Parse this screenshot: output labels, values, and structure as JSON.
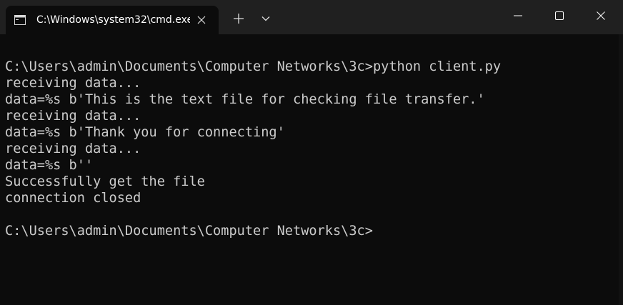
{
  "window": {
    "tab_title": "C:\\Windows\\system32\\cmd.exe",
    "tab_icon": "cmd-icon",
    "tab_close_icon": "close-icon",
    "new_tab_icon": "plus-icon",
    "dropdown_icon": "chevron-down-icon",
    "minimize_icon": "minimize-icon",
    "maximize_icon": "maximize-icon",
    "close_icon": "close-icon"
  },
  "console": {
    "lines": [
      "C:\\Users\\admin\\Documents\\Computer Networks\\3c>python client.py",
      "receiving data...",
      "data=%s b'This is the text file for checking file transfer.'",
      "receiving data...",
      "data=%s b'Thank you for connecting'",
      "receiving data...",
      "data=%s b''",
      "Successfully get the file",
      "connection closed",
      "C:\\Users\\admin\\Documents\\Computer Networks\\3c>"
    ]
  },
  "colors": {
    "titlebar": "#202020",
    "background": "#0c0c0c",
    "text": "#cccccc"
  }
}
